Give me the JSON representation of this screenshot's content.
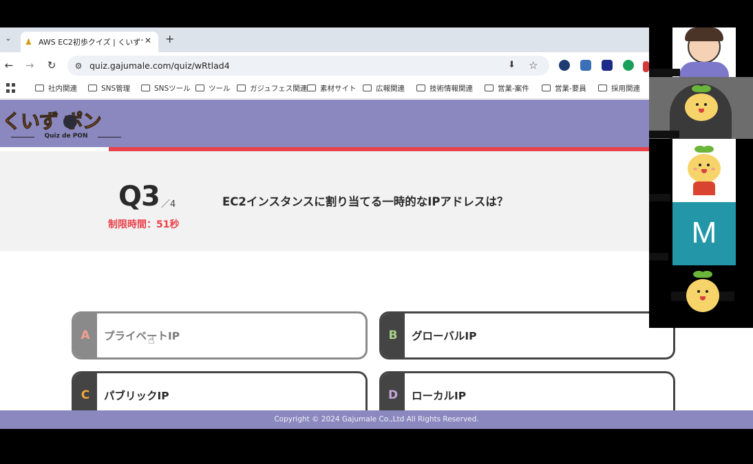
{
  "browser": {
    "tab_title": "AWS EC2初歩クイズ | くいずでポン",
    "url": "quiz.gajumale.com/quiz/wRtlad4",
    "bookmarks": [
      "社内関連",
      "SNS管理",
      "SNSツール",
      "ツール",
      "ガジュフェス関連",
      "素材サイト",
      "広報関連",
      "技術情報関連",
      "営業-案件",
      "営業-要員",
      "採用関連"
    ]
  },
  "site": {
    "logo_text": "くいず ポン",
    "logo_subtext": "Quiz de PON",
    "copyright": "Copyright © 2024 Gajumale Co.,Ltd All Rights Reserved."
  },
  "question": {
    "number": "Q3",
    "total": "／4",
    "timer": "制限時間：51秒",
    "text": "EC2インスタンスに割り当てる一時的なIPアドレスは？"
  },
  "answers": [
    {
      "letter": "A",
      "label": "プライベートIP"
    },
    {
      "letter": "B",
      "label": "グローバルIP"
    },
    {
      "letter": "C",
      "label": "パブリックIP"
    },
    {
      "letter": "D",
      "label": "ローカルIP"
    }
  ],
  "call": {
    "participant_initial": "M"
  },
  "colors": {
    "header": "#8b88bf",
    "accent_red": "#e8434b",
    "letter_a": "#f0a090",
    "letter_b": "#a8d28a",
    "letter_c": "#f2a93b",
    "letter_d": "#c4a6d8",
    "tile_teal": "#2397a8"
  }
}
